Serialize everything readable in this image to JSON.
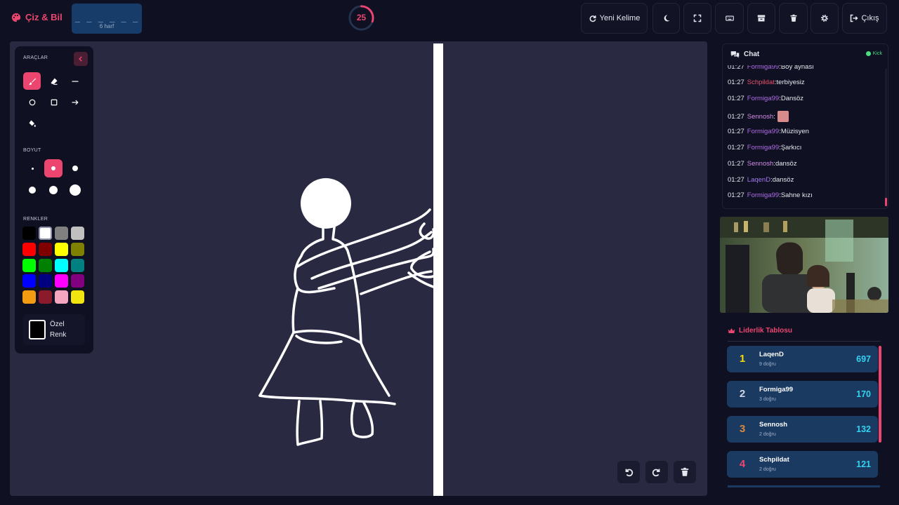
{
  "app": {
    "title": "Çiz & Bil"
  },
  "word": {
    "dashes": "_ _ _ _ _ _",
    "length_label": "6 harf"
  },
  "timer": {
    "value": "25",
    "fraction_remaining": 0.3
  },
  "toolbar": {
    "new_word_label": "Yeni Kelime",
    "logout_label": "Çıkış",
    "icons": [
      "refresh-icon",
      "moon-icon",
      "fullscreen-icon",
      "keyboard-icon",
      "archive-icon",
      "trash-icon",
      "gear-icon",
      "sign-out-icon"
    ]
  },
  "tools": {
    "section_tools": "ARAÇLAR",
    "section_size": "BOYUT",
    "section_colors": "RENKLER",
    "items": [
      "brush",
      "eraser",
      "line",
      "circle",
      "rectangle",
      "arrow",
      "fill"
    ],
    "active_tool": "brush",
    "active_size_index": 1,
    "colors": [
      "#000000",
      "#ffffff",
      "#808080",
      "#c0c0c0",
      "#ff0000",
      "#800000",
      "#ffff00",
      "#808000",
      "#00ff00",
      "#008000",
      "#00ffff",
      "#008080",
      "#0000ff",
      "#000080",
      "#ff00ff",
      "#800080",
      "#f39c12",
      "#8b1a2b",
      "#f4a6c0",
      "#f1e40f"
    ],
    "custom_color_label": "Özel Renk"
  },
  "chat": {
    "title": "Chat",
    "platform": "Kick",
    "messages": [
      {
        "time": "01:27",
        "user": "Formiga99",
        "user_color": "#b06de8",
        "text": "Boy aynası"
      },
      {
        "time": "01:27",
        "user": "Schpildat",
        "user_color": "#e8506e",
        "text": "terbiyesiz"
      },
      {
        "time": "01:27",
        "user": "Formiga99",
        "user_color": "#b06de8",
        "text": "Dansöz"
      },
      {
        "time": "01:27",
        "user": "Sennosh",
        "user_color": "#d58be8",
        "text": "",
        "emote": true
      },
      {
        "time": "01:27",
        "user": "Formiga99",
        "user_color": "#b06de8",
        "text": "Müzisyen"
      },
      {
        "time": "01:27",
        "user": "Formiga99",
        "user_color": "#b06de8",
        "text": "Şarkıcı"
      },
      {
        "time": "01:27",
        "user": "Sennosh",
        "user_color": "#d58be8",
        "text": "dansöz"
      },
      {
        "time": "01:27",
        "user": "LaqenD",
        "user_color": "#9e7af0",
        "text": "dansöz"
      },
      {
        "time": "01:27",
        "user": "Formiga99",
        "user_color": "#b06de8",
        "text": "Sahne kızı"
      }
    ]
  },
  "leaderboard": {
    "title": "Liderlik Tablosu",
    "rows": [
      {
        "rank": "1",
        "rank_color": "#f5d90a",
        "name": "LaqenD",
        "sub": "9 doğru",
        "score": "697"
      },
      {
        "rank": "2",
        "rank_color": "#cfd6e2",
        "name": "Formiga99",
        "sub": "3 doğru",
        "score": "170"
      },
      {
        "rank": "3",
        "rank_color": "#d98a3a",
        "name": "Sennosh",
        "sub": "2 doğru",
        "score": "132"
      },
      {
        "rank": "4",
        "rank_color": "#ec4670",
        "name": "Schpildat",
        "sub": "2 doğru",
        "score": "121"
      }
    ]
  },
  "colors": {
    "accent": "#ec4670",
    "panel": "#0f1021",
    "canvas": "#2a2942"
  }
}
